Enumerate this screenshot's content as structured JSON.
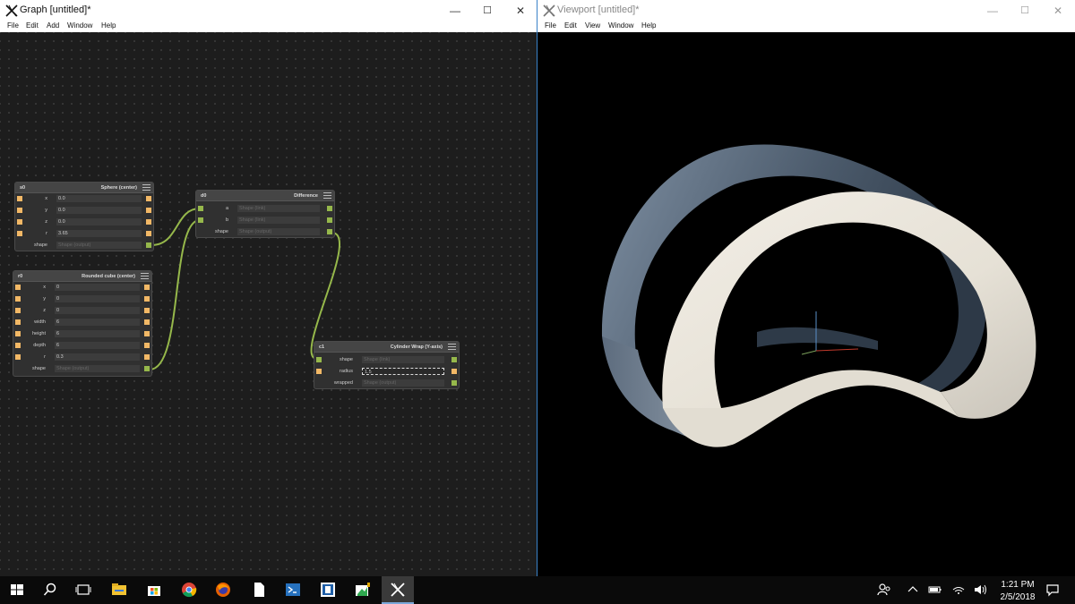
{
  "graph_window": {
    "title": "Graph [untitled]*",
    "menu": [
      "File",
      "Edit",
      "Add",
      "Window",
      "Help"
    ]
  },
  "viewport_window": {
    "title": "Viewport [untitled]*",
    "menu": [
      "File",
      "Edit",
      "View",
      "Window",
      "Help"
    ]
  },
  "window_controls": {
    "minimize": "—",
    "maximize": "☐",
    "close": "✕"
  },
  "nodes": {
    "sphere": {
      "id": "s0",
      "kind": "Sphere (center)",
      "rows": [
        {
          "label": "x",
          "value": "0.0"
        },
        {
          "label": "y",
          "value": "0.0"
        },
        {
          "label": "z",
          "value": "0.0"
        },
        {
          "label": "r",
          "value": "3.65"
        },
        {
          "label": "shape",
          "value": "Shape (output)"
        }
      ]
    },
    "rounded_cube": {
      "id": "r0",
      "kind": "Rounded cube (center)",
      "rows": [
        {
          "label": "x",
          "value": "0"
        },
        {
          "label": "y",
          "value": "0"
        },
        {
          "label": "z",
          "value": "0"
        },
        {
          "label": "width",
          "value": "6"
        },
        {
          "label": "height",
          "value": "6"
        },
        {
          "label": "depth",
          "value": "6"
        },
        {
          "label": "r",
          "value": "0.3"
        },
        {
          "label": "shape",
          "value": "Shape (output)"
        }
      ]
    },
    "difference": {
      "id": "d0",
      "kind": "Difference",
      "rows": [
        {
          "label": "a",
          "value": "Shape (link)"
        },
        {
          "label": "b",
          "value": "Shape (link)"
        },
        {
          "label": "shape",
          "value": "Shape (output)"
        }
      ]
    },
    "cylinder_wrap": {
      "id": "c1",
      "kind": "Cylinder Wrap (Y-axis)",
      "rows": [
        {
          "label": "shape",
          "value": "Shape (link)"
        },
        {
          "label": "radius",
          "value": "1.5"
        },
        {
          "label": "wrapped",
          "value": "Shape (output)"
        }
      ]
    }
  },
  "colors": {
    "number_port": "#f2b866",
    "shape_port": "#96b84b",
    "wire": "#96b84b",
    "graph_bg": "#1d1d1d",
    "viewport_bg": "#000000",
    "axis_x": "#c0392b",
    "axis_y": "#7ba05b",
    "axis_z": "#5a8fc7"
  },
  "taskbar": {
    "icons": [
      "start-icon",
      "search-icon",
      "task-view-icon",
      "file-explorer-icon",
      "store-icon",
      "chrome-icon",
      "firefox-icon",
      "notepad-icon",
      "powershell-icon",
      "app-icon",
      "paint-icon",
      "antimony-icon"
    ],
    "time": "1:21 PM",
    "date": "2/5/2018"
  }
}
